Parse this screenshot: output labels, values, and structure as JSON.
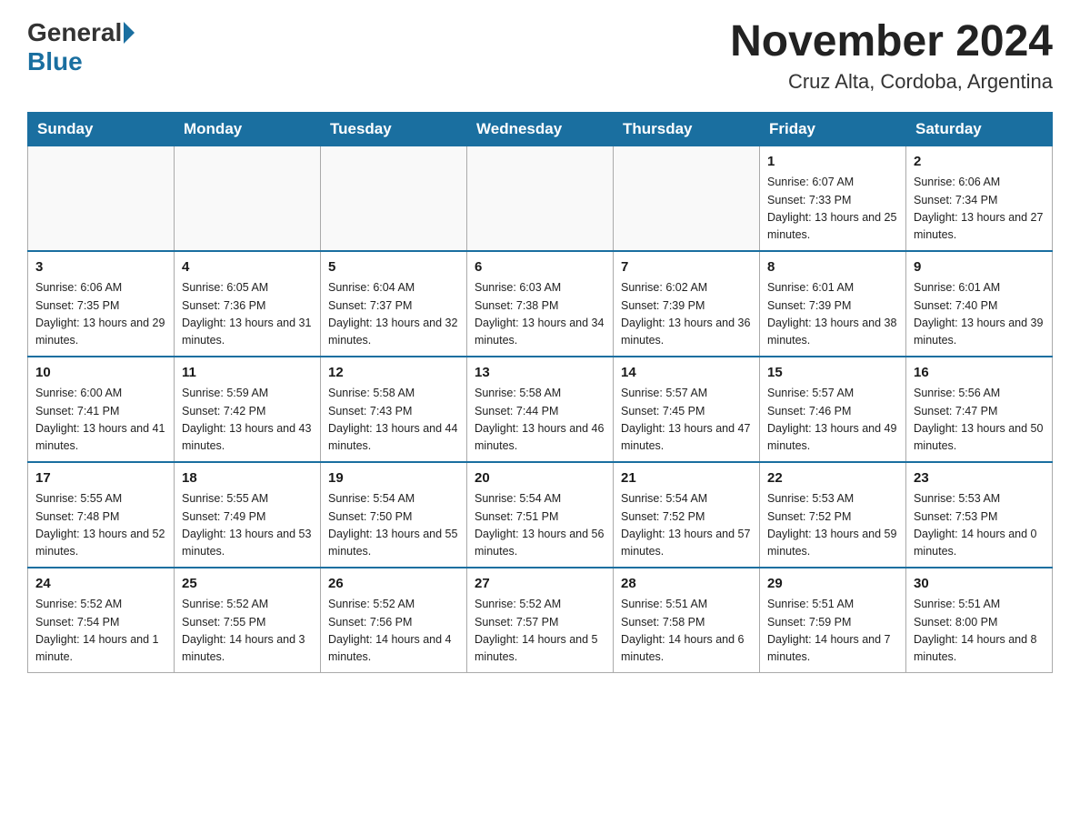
{
  "header": {
    "logo_general": "General",
    "logo_blue": "Blue",
    "month_title": "November 2024",
    "location": "Cruz Alta, Cordoba, Argentina"
  },
  "weekdays": [
    "Sunday",
    "Monday",
    "Tuesday",
    "Wednesday",
    "Thursday",
    "Friday",
    "Saturday"
  ],
  "weeks": [
    [
      {
        "day": "",
        "info": ""
      },
      {
        "day": "",
        "info": ""
      },
      {
        "day": "",
        "info": ""
      },
      {
        "day": "",
        "info": ""
      },
      {
        "day": "",
        "info": ""
      },
      {
        "day": "1",
        "info": "Sunrise: 6:07 AM\nSunset: 7:33 PM\nDaylight: 13 hours and 25 minutes."
      },
      {
        "day": "2",
        "info": "Sunrise: 6:06 AM\nSunset: 7:34 PM\nDaylight: 13 hours and 27 minutes."
      }
    ],
    [
      {
        "day": "3",
        "info": "Sunrise: 6:06 AM\nSunset: 7:35 PM\nDaylight: 13 hours and 29 minutes."
      },
      {
        "day": "4",
        "info": "Sunrise: 6:05 AM\nSunset: 7:36 PM\nDaylight: 13 hours and 31 minutes."
      },
      {
        "day": "5",
        "info": "Sunrise: 6:04 AM\nSunset: 7:37 PM\nDaylight: 13 hours and 32 minutes."
      },
      {
        "day": "6",
        "info": "Sunrise: 6:03 AM\nSunset: 7:38 PM\nDaylight: 13 hours and 34 minutes."
      },
      {
        "day": "7",
        "info": "Sunrise: 6:02 AM\nSunset: 7:39 PM\nDaylight: 13 hours and 36 minutes."
      },
      {
        "day": "8",
        "info": "Sunrise: 6:01 AM\nSunset: 7:39 PM\nDaylight: 13 hours and 38 minutes."
      },
      {
        "day": "9",
        "info": "Sunrise: 6:01 AM\nSunset: 7:40 PM\nDaylight: 13 hours and 39 minutes."
      }
    ],
    [
      {
        "day": "10",
        "info": "Sunrise: 6:00 AM\nSunset: 7:41 PM\nDaylight: 13 hours and 41 minutes."
      },
      {
        "day": "11",
        "info": "Sunrise: 5:59 AM\nSunset: 7:42 PM\nDaylight: 13 hours and 43 minutes."
      },
      {
        "day": "12",
        "info": "Sunrise: 5:58 AM\nSunset: 7:43 PM\nDaylight: 13 hours and 44 minutes."
      },
      {
        "day": "13",
        "info": "Sunrise: 5:58 AM\nSunset: 7:44 PM\nDaylight: 13 hours and 46 minutes."
      },
      {
        "day": "14",
        "info": "Sunrise: 5:57 AM\nSunset: 7:45 PM\nDaylight: 13 hours and 47 minutes."
      },
      {
        "day": "15",
        "info": "Sunrise: 5:57 AM\nSunset: 7:46 PM\nDaylight: 13 hours and 49 minutes."
      },
      {
        "day": "16",
        "info": "Sunrise: 5:56 AM\nSunset: 7:47 PM\nDaylight: 13 hours and 50 minutes."
      }
    ],
    [
      {
        "day": "17",
        "info": "Sunrise: 5:55 AM\nSunset: 7:48 PM\nDaylight: 13 hours and 52 minutes."
      },
      {
        "day": "18",
        "info": "Sunrise: 5:55 AM\nSunset: 7:49 PM\nDaylight: 13 hours and 53 minutes."
      },
      {
        "day": "19",
        "info": "Sunrise: 5:54 AM\nSunset: 7:50 PM\nDaylight: 13 hours and 55 minutes."
      },
      {
        "day": "20",
        "info": "Sunrise: 5:54 AM\nSunset: 7:51 PM\nDaylight: 13 hours and 56 minutes."
      },
      {
        "day": "21",
        "info": "Sunrise: 5:54 AM\nSunset: 7:52 PM\nDaylight: 13 hours and 57 minutes."
      },
      {
        "day": "22",
        "info": "Sunrise: 5:53 AM\nSunset: 7:52 PM\nDaylight: 13 hours and 59 minutes."
      },
      {
        "day": "23",
        "info": "Sunrise: 5:53 AM\nSunset: 7:53 PM\nDaylight: 14 hours and 0 minutes."
      }
    ],
    [
      {
        "day": "24",
        "info": "Sunrise: 5:52 AM\nSunset: 7:54 PM\nDaylight: 14 hours and 1 minute."
      },
      {
        "day": "25",
        "info": "Sunrise: 5:52 AM\nSunset: 7:55 PM\nDaylight: 14 hours and 3 minutes."
      },
      {
        "day": "26",
        "info": "Sunrise: 5:52 AM\nSunset: 7:56 PM\nDaylight: 14 hours and 4 minutes."
      },
      {
        "day": "27",
        "info": "Sunrise: 5:52 AM\nSunset: 7:57 PM\nDaylight: 14 hours and 5 minutes."
      },
      {
        "day": "28",
        "info": "Sunrise: 5:51 AM\nSunset: 7:58 PM\nDaylight: 14 hours and 6 minutes."
      },
      {
        "day": "29",
        "info": "Sunrise: 5:51 AM\nSunset: 7:59 PM\nDaylight: 14 hours and 7 minutes."
      },
      {
        "day": "30",
        "info": "Sunrise: 5:51 AM\nSunset: 8:00 PM\nDaylight: 14 hours and 8 minutes."
      }
    ]
  ]
}
